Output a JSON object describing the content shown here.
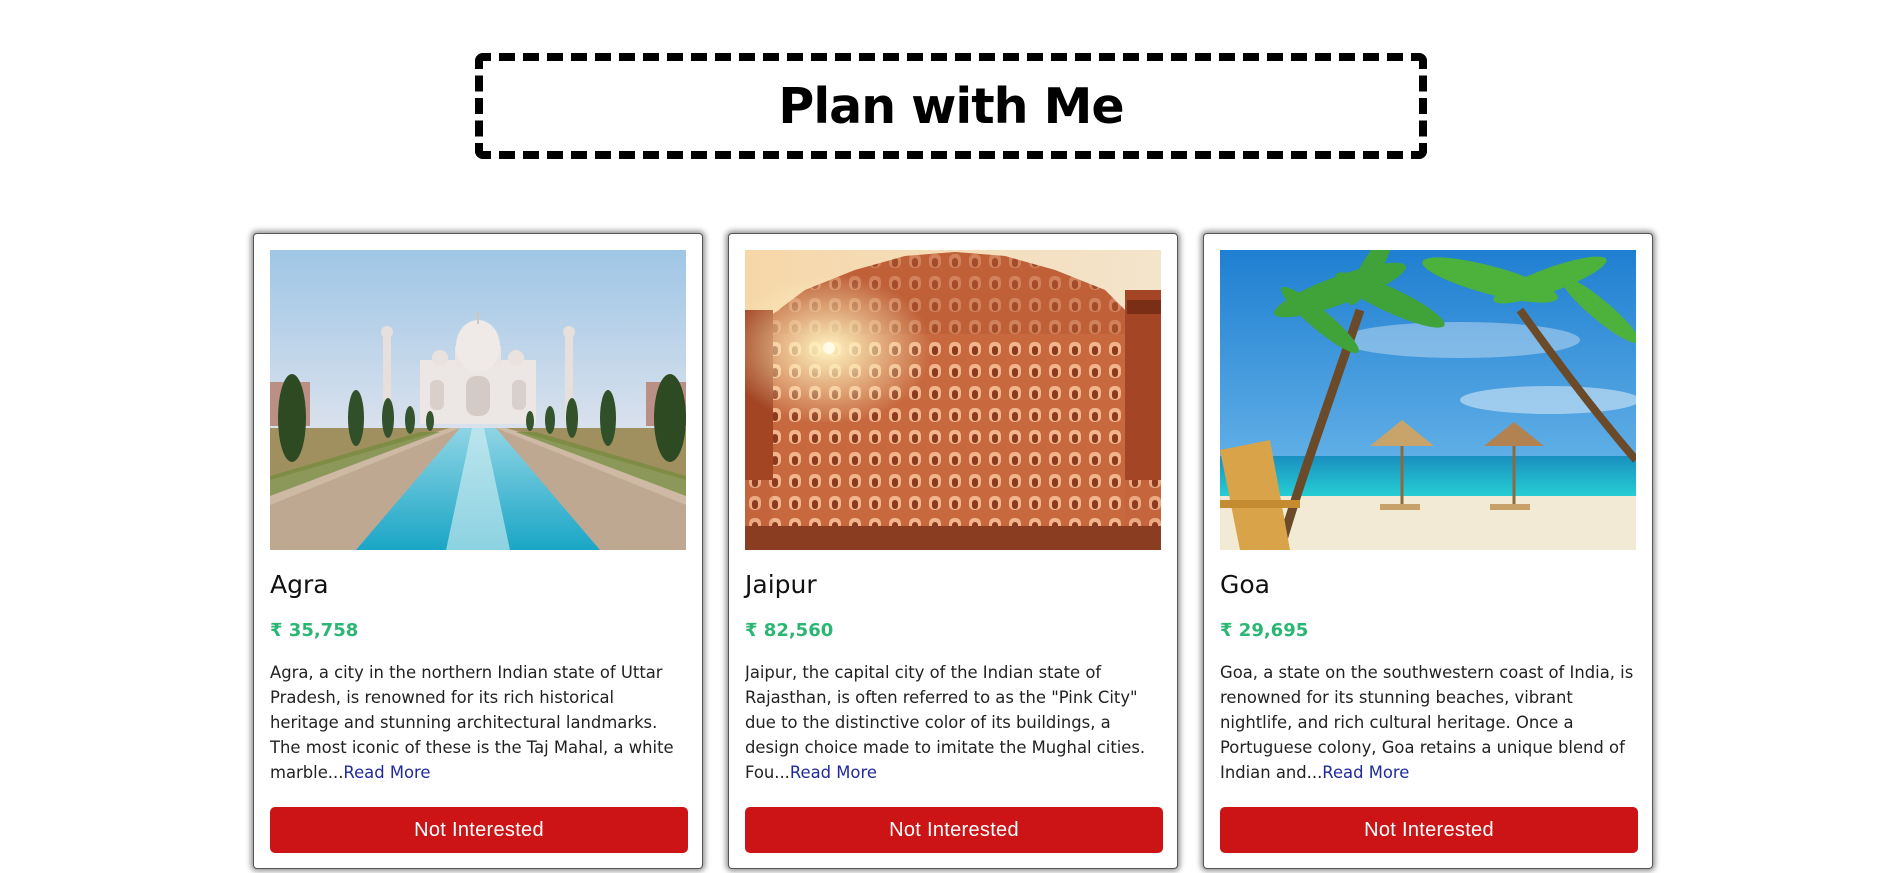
{
  "header": {
    "title": "Plan with Me"
  },
  "tours": [
    {
      "name": "Agra",
      "price": "₹ 35,758",
      "description": "Agra, a city in the northern Indian state of Uttar Pradesh, is renowned for its rich historical heritage and stunning architectural landmarks. The most iconic of these is the Taj Mahal, a white marble...",
      "read_more": "Read More",
      "button": "Not Interested",
      "image": "taj-mahal-photo"
    },
    {
      "name": "Jaipur",
      "price": "₹ 82,560",
      "description": "Jaipur, the capital city of the Indian state of Rajasthan, is often referred to as the \"Pink City\" due to the distinctive color of its buildings, a design choice made to imitate the Mughal cities. Fou...",
      "read_more": "Read More",
      "button": "Not Interested",
      "image": "hawa-mahal-photo"
    },
    {
      "name": "Goa",
      "price": "₹ 29,695",
      "description": "Goa, a state on the southwestern coast of India, is renowned for its stunning beaches, vibrant nightlife, and rich cultural heritage. Once a Portuguese colony, Goa retains a unique blend of Indian and...",
      "read_more": "Read More",
      "button": "Not Interested",
      "image": "beach-palms-photo"
    }
  ],
  "colors": {
    "price": "#2bb673",
    "button": "#cc1416",
    "link": "#1f2a9c",
    "title_border": "#000000"
  }
}
